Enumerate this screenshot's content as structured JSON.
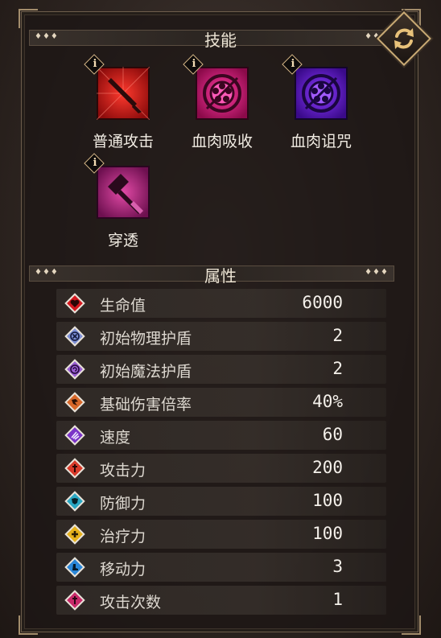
{
  "skills_section": {
    "title": "技能",
    "dots": "♦♦♦"
  },
  "skills": [
    {
      "label": "普通攻击",
      "icon": "sword-icon",
      "color": "#d0201c"
    },
    {
      "label": "血肉吸收",
      "icon": "flesh-absorb-icon",
      "color": "#e0207c"
    },
    {
      "label": "血肉诅咒",
      "icon": "flesh-curse-icon",
      "color": "#7a1fd6"
    },
    {
      "label": "穿透",
      "icon": "hammer-icon",
      "color": "#b0237f"
    }
  ],
  "attributes_section": {
    "title": "属性",
    "dots": "♦♦♦"
  },
  "attributes": [
    {
      "label": "生命值",
      "value": "6000",
      "icon": "heart-icon",
      "color": "#d4181f"
    },
    {
      "label": "初始物理护盾",
      "value": "2",
      "icon": "physical-shield-icon",
      "color": "#7d8fd6"
    },
    {
      "label": "初始魔法护盾",
      "value": "2",
      "icon": "magic-shield-icon",
      "color": "#9a5ed2"
    },
    {
      "label": "基础伤害倍率",
      "value": "40%",
      "icon": "damage-rate-icon",
      "color": "#d8682a"
    },
    {
      "label": "速度",
      "value": "60",
      "icon": "speed-icon",
      "color": "#7b34c8"
    },
    {
      "label": "攻击力",
      "value": "200",
      "icon": "attack-icon",
      "color": "#d83a2a"
    },
    {
      "label": "防御力",
      "value": "100",
      "icon": "defense-icon",
      "color": "#2aa8c4"
    },
    {
      "label": "治疗力",
      "value": "100",
      "icon": "heal-icon",
      "color": "#e6b21c"
    },
    {
      "label": "移动力",
      "value": "3",
      "icon": "move-icon",
      "color": "#2a86d8"
    },
    {
      "label": "攻击次数",
      "value": "1",
      "icon": "attack-count-icon",
      "color": "#c82a6a"
    }
  ]
}
